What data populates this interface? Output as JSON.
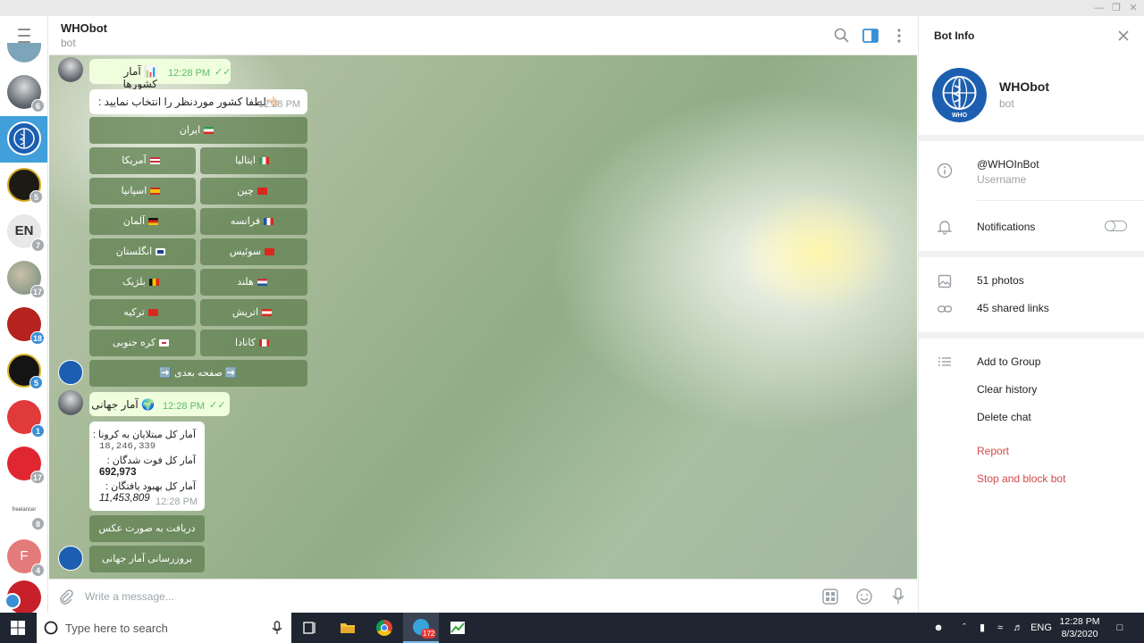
{
  "app": {
    "colors": {
      "accent": "#419fd9",
      "bubble_out": "#effedd",
      "keyboard_button": "#6a8a5a",
      "danger": "#d24949",
      "taskbar": "#1f2631"
    }
  },
  "chat_list": [
    {
      "badge": "",
      "icon": "group-avatar"
    },
    {
      "badge": "6",
      "icon": "person-photo-avatar"
    },
    {
      "badge": "",
      "icon": "who-logo-avatar",
      "selected": true
    },
    {
      "badge": "5",
      "icon": "channel-avatar"
    },
    {
      "badge": "7",
      "icon": "en-avatar"
    },
    {
      "badge": "17",
      "icon": "photo-avatar"
    },
    {
      "badge": "18",
      "icon": "channel-avatar"
    },
    {
      "badge": "5",
      "icon": "channel-avatar"
    },
    {
      "badge": "1",
      "icon": "channel-avatar"
    },
    {
      "badge": "17",
      "icon": "channel-avatar"
    },
    {
      "badge": "8",
      "icon": "freelancer-avatar",
      "label": "freelancer"
    },
    {
      "badge": "4",
      "icon": "letter-avatar",
      "letter": "F"
    },
    {
      "badge": "",
      "icon": "channel-avatar"
    }
  ],
  "header": {
    "title": "WHObot",
    "subtitle": "bot"
  },
  "messages": {
    "m1": {
      "text": "📊 آمار کشورها",
      "time": "12:28 PM"
    },
    "m2": {
      "text": "👈🏻لطفا کشور موردنظر را انتخاب نمایید :",
      "time": "12:28 PM"
    },
    "keyboard1": [
      {
        "label": "ایران",
        "flag": "iran"
      },
      {
        "label": "آمریکا",
        "flag": "usa"
      },
      {
        "label": "ایتالیا",
        "flag": "italy"
      },
      {
        "label": "اسپانیا",
        "flag": "spain"
      },
      {
        "label": "چین",
        "flag": "china"
      },
      {
        "label": "آلمان",
        "flag": "germany"
      },
      {
        "label": "فرانسه",
        "flag": "france"
      },
      {
        "label": "انگلستان",
        "flag": "uk"
      },
      {
        "label": "سوئیس",
        "flag": "switzerland"
      },
      {
        "label": "بلژیک",
        "flag": "belgium"
      },
      {
        "label": "هلند",
        "flag": "netherlands"
      },
      {
        "label": "ترکیه",
        "flag": "turkey"
      },
      {
        "label": "اتریش",
        "flag": "austria"
      },
      {
        "label": "کره جنوبی",
        "flag": "south-korea"
      },
      {
        "label": "کانادا",
        "flag": "canada"
      },
      {
        "label": "➡️ صفحه بعدی ➡️",
        "flag": ""
      }
    ],
    "m3": {
      "text": "🌍 آمار جهانی",
      "time": "12:28 PM"
    },
    "m4": {
      "infected_label": "آمار کل مبتلایان به کرونا :",
      "infected": "18,246,339",
      "deaths_label": "آمار کل فوت شدگان :",
      "deaths": "692,973",
      "recovered_label": "آمار کل بهبود یافتگان :",
      "recovered": "11,453,809",
      "time": "12:28 PM"
    },
    "keyboard2": [
      {
        "label": "دریافت به صورت عکس"
      },
      {
        "label": "بروزرسانی آمار جهانی"
      }
    ]
  },
  "composer": {
    "placeholder": "Write a message..."
  },
  "info_panel": {
    "title": "Bot Info",
    "bot_name": "WHObot",
    "bot_type": "bot",
    "username": "@WHOInBot",
    "username_label": "Username",
    "notifications_label": "Notifications",
    "notifications_on": false,
    "photos": "51 photos",
    "links": "45 shared links",
    "add_to_group": "Add to Group",
    "clear_history": "Clear history",
    "delete_chat": "Delete chat",
    "report": "Report",
    "stop_block": "Stop and block bot"
  },
  "taskbar": {
    "search_placeholder": "Type here to search",
    "telegram_badge": "172",
    "lang": "ENG",
    "time": "12:28 PM",
    "date": "8/3/2020"
  }
}
